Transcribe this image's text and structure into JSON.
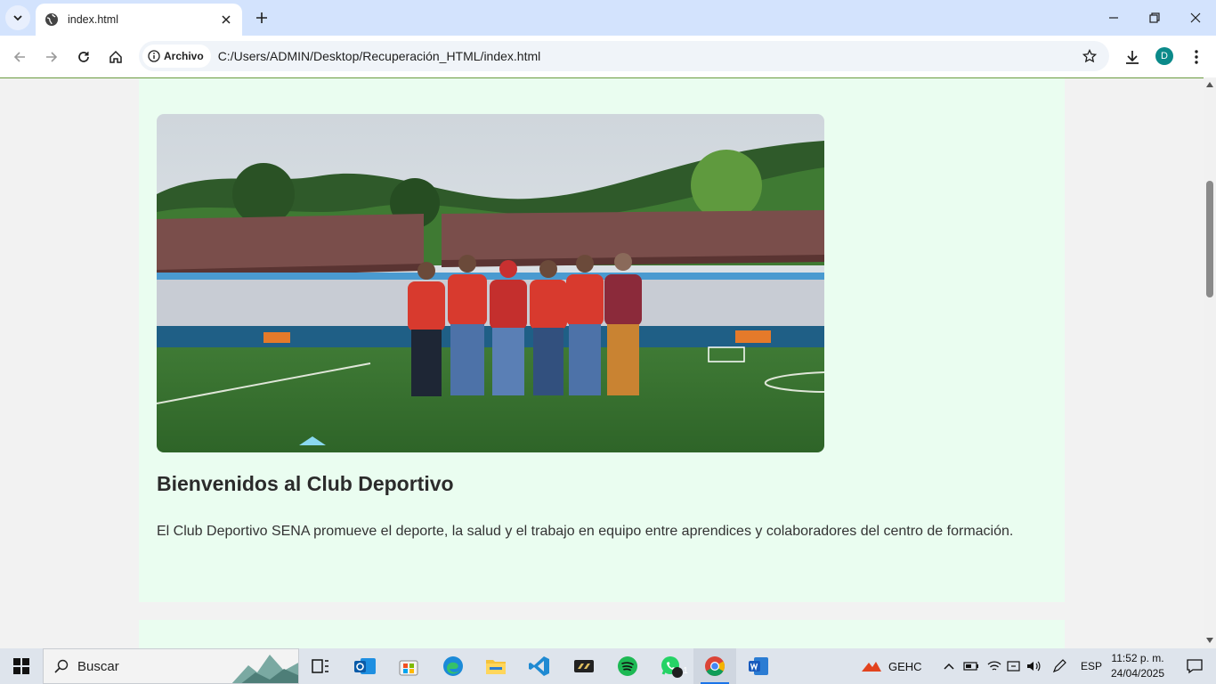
{
  "browser": {
    "tab_title": "index.html",
    "omnibox_chip": "Archivo",
    "url": "C:/Users/ADMIN/Desktop/Recuperación_HTML/index.html",
    "profile_initial": "D",
    "accent_color": "#d3e3fd",
    "avatar_color": "#0b8a8a"
  },
  "page": {
    "background": "#eafdf0",
    "welcome_title": "Bienvenidos al Club Deportivo",
    "welcome_text": "El Club Deportivo SENA promueve el deporte, la salud y el trabajo en equipo entre aprendices y colaboradores del centro de formación."
  },
  "taskbar": {
    "search_label": "Buscar",
    "tray_gehc": "GEHC",
    "language": "ESP",
    "time": "11:52 p. m.",
    "date": "24/04/2025",
    "whatsapp_badge": "1",
    "apps": [
      "task-view",
      "outlook",
      "microsoft-store",
      "edge",
      "file-explorer",
      "vscode",
      "media-app",
      "spotify",
      "whatsapp",
      "chrome",
      "word"
    ]
  }
}
